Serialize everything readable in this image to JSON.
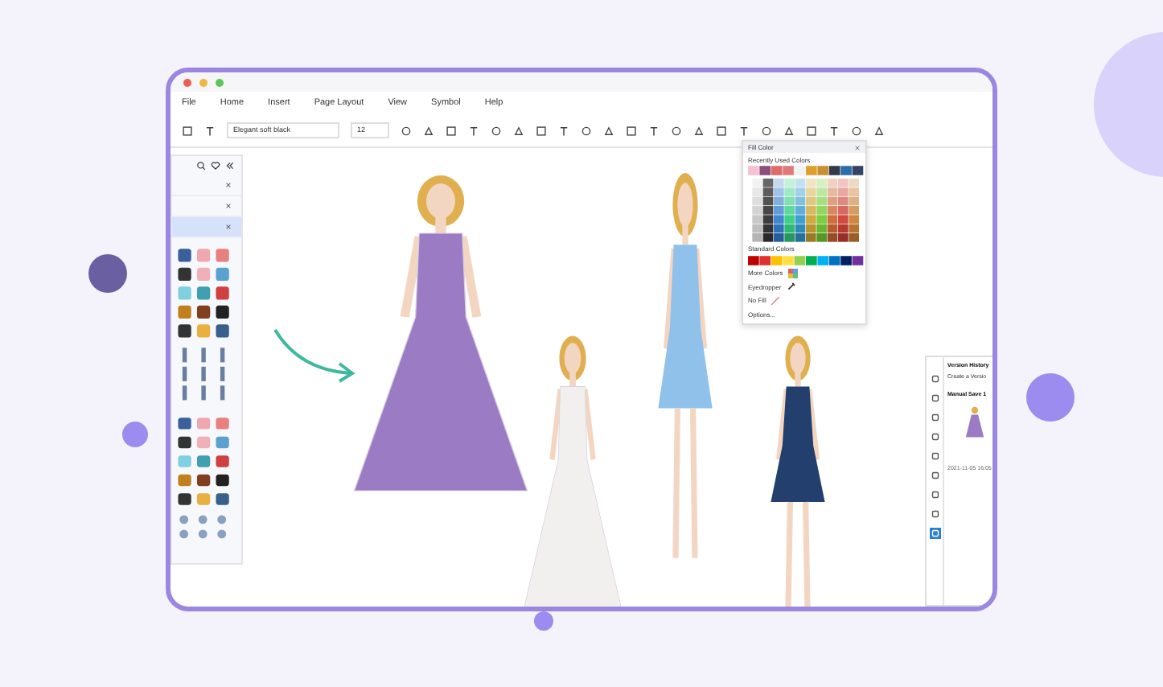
{
  "window": {
    "menu": [
      "File",
      "Home",
      "Insert",
      "Page Layout",
      "View",
      "Symbol",
      "Help"
    ]
  },
  "toolbar": {
    "font": "Elegant soft black",
    "size": "12"
  },
  "library_panel": {
    "rows": [
      {
        "selected": false
      },
      {
        "selected": false
      },
      {
        "selected": true
      }
    ]
  },
  "fill_color_panel": {
    "title": "Fill Color",
    "recent_label": "Recently Used Colors",
    "standard_label": "Standard Colors",
    "options": [
      {
        "label": "More Colors",
        "kind": "swatch"
      },
      {
        "label": "Eyedropper",
        "kind": "dropper"
      },
      {
        "label": "No Fill",
        "kind": "nofill"
      },
      {
        "label": "Options...",
        "kind": "plain"
      }
    ]
  },
  "version_panel": {
    "title": "Version History",
    "create": "Create a Versio",
    "save_name": "Manual Save 1",
    "save_time": "2021-11-05 16:05"
  },
  "side_tools": [
    {
      "selected": false
    },
    {
      "selected": false
    },
    {
      "selected": false
    },
    {
      "selected": false
    },
    {
      "selected": false
    },
    {
      "selected": false
    },
    {
      "selected": false
    },
    {
      "selected": false
    },
    {
      "selected": true
    }
  ]
}
